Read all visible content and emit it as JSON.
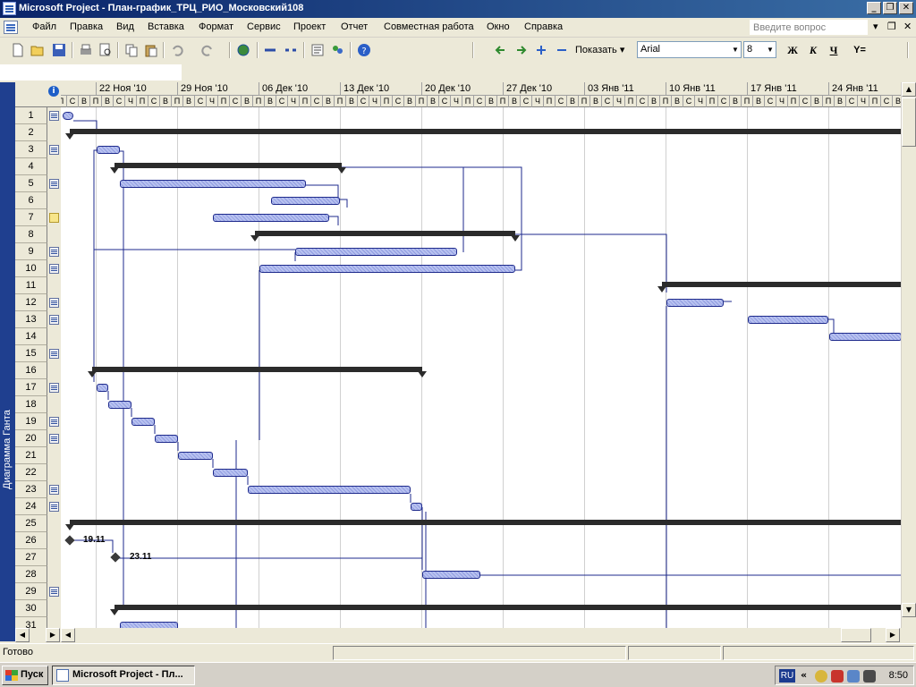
{
  "window": {
    "title": "Microsoft Project - План-график_ТРЦ_РИО_Московский108",
    "minimize": "_",
    "restore": "❐",
    "close": "✕"
  },
  "menu": {
    "items": [
      "Файл",
      "Правка",
      "Вид",
      "Вставка",
      "Формат",
      "Сервис",
      "Проект",
      "Отчет",
      "Совместная работа",
      "Окно",
      "Справка"
    ],
    "ask_placeholder": "Введите вопрос",
    "doc_close": "✕",
    "doc_restore": "❐"
  },
  "toolbar": {
    "show_label": "Показать ▾",
    "font_name": "Arial",
    "font_size": "8",
    "bold": "Ж",
    "italic": "К",
    "underline": "Ч",
    "filter_label": "Y="
  },
  "view": {
    "label": "Диаграмма Ганта"
  },
  "timescale": {
    "weeks": [
      "22 Ноя '10",
      "29 Ноя '10",
      "06 Дек '10",
      "13 Дек '10",
      "20 Дек '10",
      "27 Дек '10",
      "03 Янв '11",
      "10 Янв '11",
      "17 Янв '11",
      "24 Янв '11"
    ],
    "day_letters": [
      "П",
      "В",
      "С",
      "Ч",
      "П",
      "С",
      "В"
    ]
  },
  "rows": {
    "numbers": [
      "1",
      "2",
      "3",
      "4",
      "5",
      "6",
      "7",
      "8",
      "9",
      "10",
      "11",
      "12",
      "13",
      "14",
      "15",
      "16",
      "17",
      "18",
      "19",
      "20",
      "21",
      "22",
      "23",
      "24",
      "25",
      "26",
      "27",
      "28",
      "29",
      "30",
      "31"
    ]
  },
  "milestones": {
    "m26": "19.11",
    "m27": "23.11"
  },
  "status": {
    "ready": "Готово"
  },
  "taskbar": {
    "start": "Пуск",
    "task": "Microsoft Project - Пл...",
    "lang": "RU",
    "tray_chevron": "«",
    "clock": "8:50"
  }
}
